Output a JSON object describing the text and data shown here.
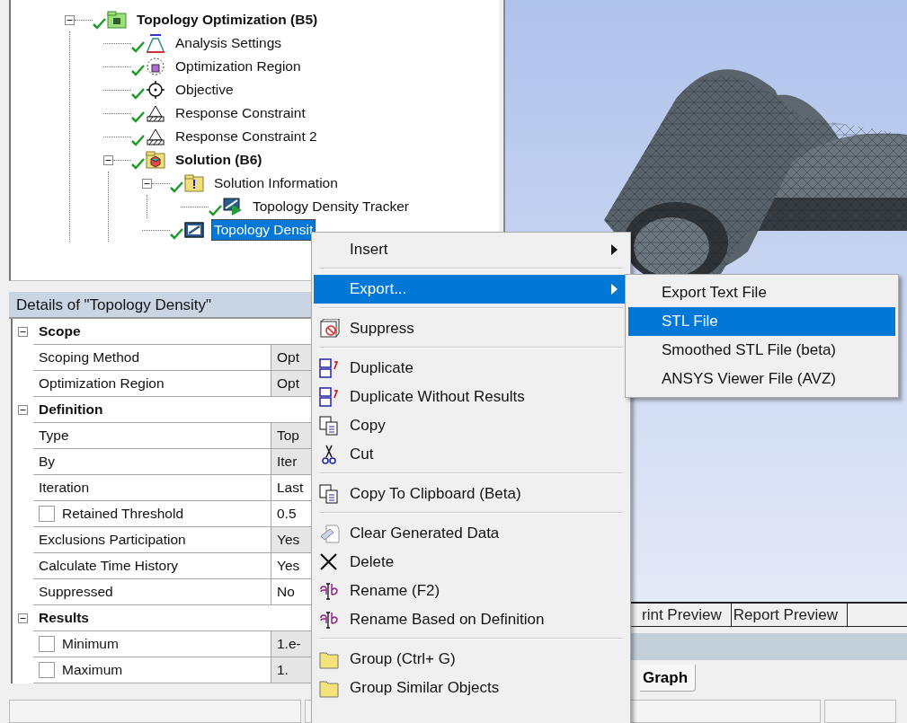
{
  "tree": [
    {
      "label": "Topology Optimization (B5)",
      "bold": true,
      "selected": false,
      "expanded": true,
      "children": [
        {
          "label": "Analysis Settings",
          "bold": false,
          "selected": false
        },
        {
          "label": "Optimization Region",
          "bold": false,
          "selected": false
        },
        {
          "label": "Objective",
          "bold": false,
          "selected": false
        },
        {
          "label": "Response Constraint",
          "bold": false,
          "selected": false
        },
        {
          "label": "Response Constraint 2",
          "bold": false,
          "selected": false
        },
        {
          "label": "Solution (B6)",
          "bold": true,
          "selected": false,
          "expanded": true,
          "children": [
            {
              "label": "Solution Information",
              "bold": false,
              "selected": false,
              "expanded": true,
              "children": [
                {
                  "label": "Topology Density Tracker",
                  "bold": false,
                  "selected": false
                }
              ]
            },
            {
              "label": "Topology Densit",
              "bold": false,
              "selected": true
            }
          ]
        }
      ]
    }
  ],
  "details": {
    "title": "Details of \"Topology Density\"",
    "rows": [
      {
        "kind": "section",
        "label": "Scope",
        "expanded": true
      },
      {
        "kind": "property",
        "label": "Scoping Method",
        "value": "Opt",
        "readonly": true
      },
      {
        "kind": "property",
        "label": "Optimization Region",
        "value": "Opt",
        "readonly": true
      },
      {
        "kind": "section",
        "label": "Definition",
        "expanded": true
      },
      {
        "kind": "property",
        "label": "Type",
        "value": "Top",
        "readonly": true
      },
      {
        "kind": "property",
        "label": "By",
        "value": "Iter",
        "readonly": true
      },
      {
        "kind": "property",
        "label": "Iteration",
        "value": "Last",
        "readonly": false
      },
      {
        "kind": "check",
        "label": "Retained Threshold",
        "value": "0.5",
        "readonly": false,
        "checked": false
      },
      {
        "kind": "property",
        "label": "Exclusions Participation",
        "value": "Yes",
        "readonly": true
      },
      {
        "kind": "property",
        "label": "Calculate Time History",
        "value": "Yes",
        "readonly": false
      },
      {
        "kind": "property",
        "label": "Suppressed",
        "value": "No",
        "readonly": false
      },
      {
        "kind": "section",
        "label": "Results",
        "expanded": true
      },
      {
        "kind": "check",
        "label": "Minimum",
        "value": "1.e-",
        "readonly": true,
        "checked": false
      },
      {
        "kind": "check",
        "label": "Maximum",
        "value": "1.",
        "readonly": true,
        "checked": false
      }
    ]
  },
  "bottom_tabs": [
    {
      "label": "rint Preview",
      "selected": false
    },
    {
      "label": "Report Preview",
      "selected": false
    }
  ],
  "graph_tabs": [
    {
      "label": "Graph",
      "selected": true
    }
  ],
  "context_menu": {
    "items": [
      {
        "kind": "item",
        "label": "Insert",
        "has_submenu": true,
        "selected": false
      },
      {
        "kind": "separator"
      },
      {
        "kind": "item",
        "label": "Export...",
        "has_submenu": true,
        "selected": true
      },
      {
        "kind": "separator"
      },
      {
        "kind": "item",
        "label": "Suppress",
        "has_submenu": false,
        "selected": false
      },
      {
        "kind": "separator"
      },
      {
        "kind": "item",
        "label": "Duplicate",
        "has_submenu": false,
        "selected": false
      },
      {
        "kind": "item",
        "label": "Duplicate Without Results",
        "has_submenu": false,
        "selected": false
      },
      {
        "kind": "item",
        "label": "Copy",
        "has_submenu": false,
        "selected": false
      },
      {
        "kind": "item",
        "label": "Cut",
        "has_submenu": false,
        "selected": false
      },
      {
        "kind": "separator"
      },
      {
        "kind": "item",
        "label": "Copy To Clipboard (Beta)",
        "has_submenu": false,
        "selected": false
      },
      {
        "kind": "separator"
      },
      {
        "kind": "item",
        "label": "Clear Generated Data",
        "has_submenu": false,
        "selected": false
      },
      {
        "kind": "item",
        "label": "Delete",
        "has_submenu": false,
        "selected": false
      },
      {
        "kind": "item",
        "label": "Rename (F2)",
        "has_submenu": false,
        "selected": false
      },
      {
        "kind": "item",
        "label": "Rename Based on Definition",
        "has_submenu": false,
        "selected": false
      },
      {
        "kind": "separator"
      },
      {
        "kind": "item",
        "label": "Group (Ctrl+ G)",
        "has_submenu": false,
        "selected": false
      },
      {
        "kind": "item",
        "label": "Group Similar Objects",
        "has_submenu": false,
        "selected": false
      }
    ]
  },
  "submenu": {
    "items": [
      {
        "label": "Export Text File",
        "selected": false
      },
      {
        "label": "STL File",
        "selected": true
      },
      {
        "label": "Smoothed STL File (beta)",
        "selected": false
      },
      {
        "label": "ANSYS Viewer File (AVZ)",
        "selected": false
      }
    ]
  }
}
